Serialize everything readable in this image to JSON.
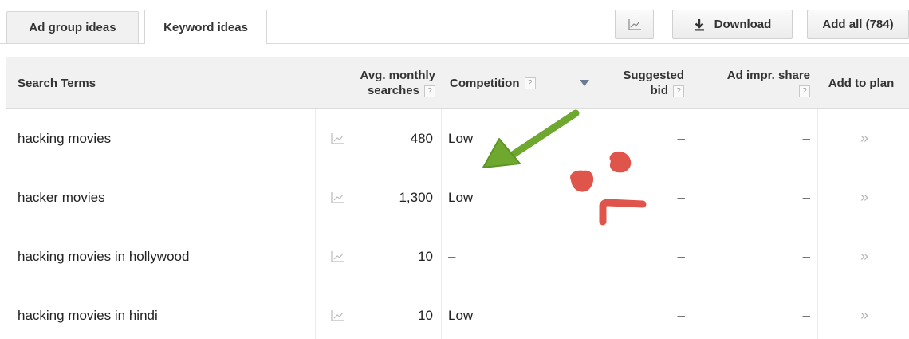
{
  "tabs": [
    {
      "label": "Ad group ideas"
    },
    {
      "label": "Keyword ideas"
    }
  ],
  "toolbar": {
    "chart_icon": "line-chart-icon",
    "download_icon": "download-icon",
    "download_label": "Download",
    "add_all_label": "Add all (784)"
  },
  "table": {
    "headers": {
      "search_terms": "Search Terms",
      "avg_line1": "Avg. monthly",
      "avg_line2": "searches",
      "competition": "Competition",
      "bid_line1": "Suggested",
      "bid_line2": "bid",
      "impr": "Ad impr. share",
      "add": "Add to plan",
      "help": "?",
      "sort_icon": "sort-desc-icon"
    },
    "rows": [
      {
        "term": "hacking movies",
        "searches": "480",
        "competition": "Low",
        "bid": "–",
        "impr": "–",
        "add": "»"
      },
      {
        "term": "hacker movies",
        "searches": "1,300",
        "competition": "Low",
        "bid": "–",
        "impr": "–",
        "add": "»"
      },
      {
        "term": "hacking movies in hollywood",
        "searches": "10",
        "competition": "–",
        "bid": "–",
        "impr": "–",
        "add": "»"
      },
      {
        "term": "hacking movies in hindi",
        "searches": "10",
        "competition": "Low",
        "bid": "–",
        "impr": "–",
        "add": "»"
      }
    ]
  },
  "annotations": {
    "arrow_color": "#6ea82f",
    "doodle_color": "#e0554b",
    "arrow_icon": "green-arrow-annotation",
    "doodle_icon": "frowny-face-doodle"
  }
}
